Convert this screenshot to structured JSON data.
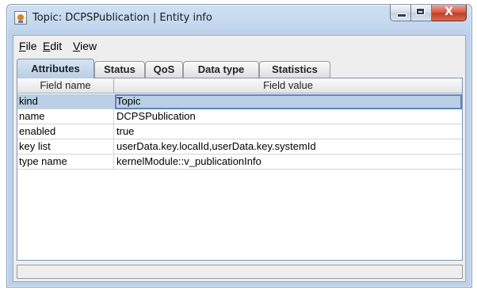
{
  "window": {
    "title": "Topic: DCPSPublication | Entity info",
    "icon": "java-app-icon",
    "controls": {
      "minimize": "minimize-icon",
      "maximize": "maximize-icon",
      "close_glyph": "X"
    }
  },
  "menu": [
    {
      "label_underlined": "F",
      "label_rest": "ile"
    },
    {
      "label_underlined": "E",
      "label_rest": "dit"
    },
    {
      "label_underlined": "V",
      "label_rest": "iew"
    }
  ],
  "tabs": [
    {
      "label": "Attributes",
      "active": true
    },
    {
      "label": "Status",
      "active": false
    },
    {
      "label": "QoS",
      "active": false
    },
    {
      "label": "Data type",
      "active": false
    },
    {
      "label": "Statistics",
      "active": false
    }
  ],
  "table": {
    "columns": [
      "Field name",
      "Field value"
    ],
    "rows": [
      {
        "name": "kind",
        "value": "Topic",
        "selected": true
      },
      {
        "name": "name",
        "value": "DCPSPublication",
        "selected": false
      },
      {
        "name": "enabled",
        "value": "true",
        "selected": false
      },
      {
        "name": "key list",
        "value": "userData.key.localId,userData.key.systemId",
        "selected": false
      },
      {
        "name": "type name",
        "value": "kernelModule::v_publicationInfo",
        "selected": false
      }
    ]
  },
  "status_bar": {
    "text": ""
  }
}
